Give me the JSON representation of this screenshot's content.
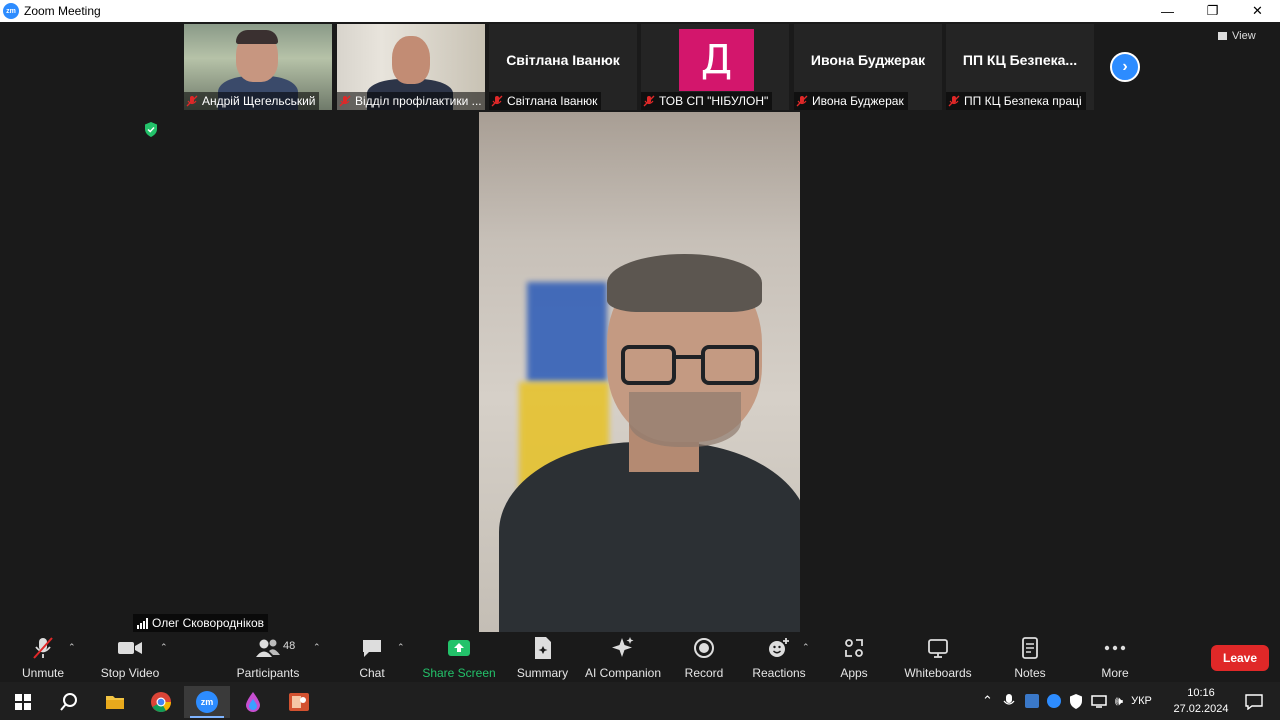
{
  "window": {
    "title": "Zoom Meeting",
    "logo_text": "zm",
    "minimize": "—",
    "restore": "❐",
    "close": "✕"
  },
  "top_bar": {
    "view_label": "View"
  },
  "participants_strip": [
    {
      "label": "Андрій Щегельський",
      "type": "video"
    },
    {
      "label": "Відділ профілактики ...",
      "type": "video"
    },
    {
      "display_name": "Світлана Іванюк",
      "label": "Світлана Іванюк",
      "type": "name"
    },
    {
      "avatar_letter": "Д",
      "label": "ТОВ СП \"НІБУЛОН\"",
      "type": "avatar"
    },
    {
      "display_name": "Ивона Буджерак",
      "label": "Ивона Буджерак",
      "type": "name"
    },
    {
      "display_name": "ПП  КЦ  Безпека...",
      "label": "ПП КЦ Безпека праці",
      "type": "name"
    }
  ],
  "active_speaker": {
    "name": "Олег Сковороднiков"
  },
  "toolbar": {
    "unmute": "Unmute",
    "stop_video": "Stop Video",
    "participants": "Participants",
    "participants_count": "48",
    "chat": "Chat",
    "share_screen": "Share Screen",
    "summary": "Summary",
    "ai_companion": "AI Companion",
    "record": "Record",
    "reactions": "Reactions",
    "apps": "Apps",
    "whiteboards": "Whiteboards",
    "notes": "Notes",
    "more": "More",
    "leave": "Leave"
  },
  "taskbar": {
    "zoom_icon_text": "zm",
    "language": "УКР",
    "time": "10:16",
    "date": "27.02.2024"
  },
  "colors": {
    "accent": "#2d8cff",
    "share_green": "#23c26a",
    "leave_red": "#e02828",
    "avatar_pink": "#d3166c"
  }
}
